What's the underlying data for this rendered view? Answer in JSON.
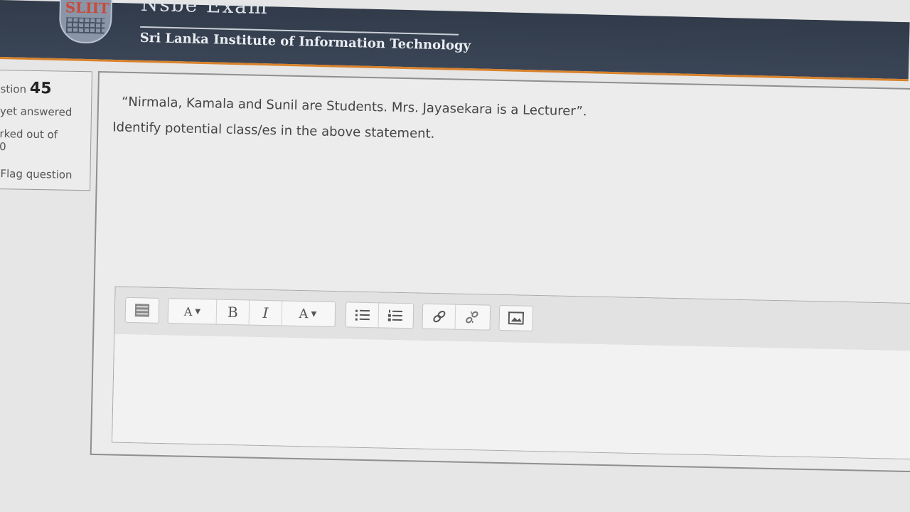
{
  "header": {
    "logo_text": "SLIIT",
    "brand_text": "Nsbe Exam",
    "org_name": "Sri Lanka Institute of Information Technology"
  },
  "question_info": {
    "label": "stion",
    "number": "45",
    "status": "yet answered",
    "marked_line1": "rked out of",
    "marked_line2": "0",
    "flag_label": "Flag question"
  },
  "question": {
    "line1": "“Nirmala, Kamala and Sunil are Students. Mrs. Jayasekara is a Lecturer”.",
    "line2": "Identify potential class/es in the above statement."
  },
  "toolbar": {
    "font_size_glyph": "A",
    "bold_glyph": "B",
    "italic_glyph": "I",
    "color_glyph": "A",
    "icons": [
      "toolbar-toggle-icon",
      "font-size-icon",
      "bold-icon",
      "italic-icon",
      "text-color-icon",
      "bullet-list-icon",
      "numbered-list-icon",
      "link-icon",
      "unlink-icon",
      "image-icon"
    ]
  },
  "colors": {
    "header_bg": "#313b4a",
    "header_accent": "#d9822b",
    "panel_bg": "#ececec"
  }
}
